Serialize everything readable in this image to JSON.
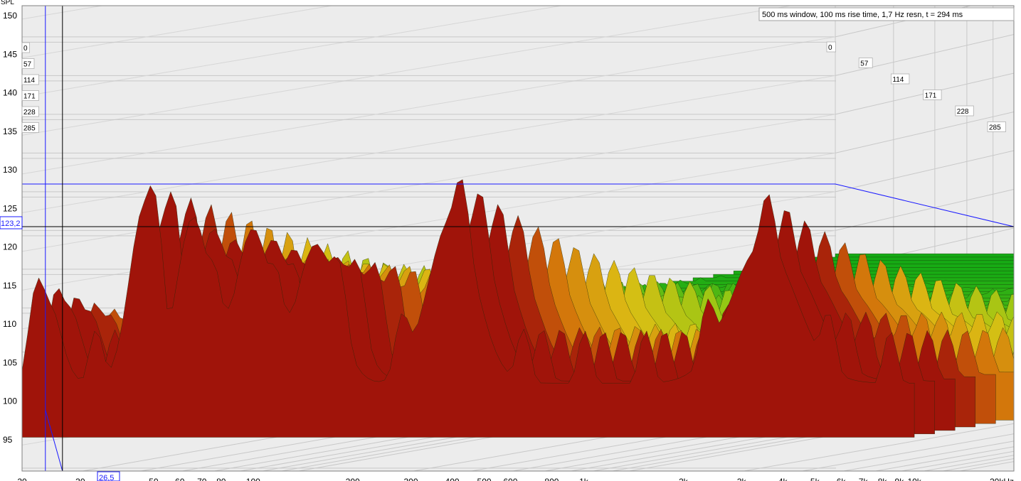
{
  "info": "500 ms window, 100 ms rise time,  1,7 Hz resn, t = 294 ms",
  "corner_label": "SPL",
  "cursor": {
    "y_label": "123,2",
    "x_label": "26,5",
    "y_value": 123.2,
    "x_value": 26.5,
    "plane_level": 128.4
  },
  "colors": {
    "cursor": "#1a1aff",
    "crosshair": "#000000",
    "grid": "#c8c8c8",
    "plot_bg": "#ececec"
  },
  "chart_data": {
    "type": "waterfall",
    "ylim": [
      91,
      151
    ],
    "y_ticks": [
      {
        "v": 150,
        "label": "150"
      },
      {
        "v": 145,
        "label": "145"
      },
      {
        "v": 140,
        "label": "140"
      },
      {
        "v": 135,
        "label": "135"
      },
      {
        "v": 130,
        "label": "130"
      },
      {
        "v": 125,
        "label": "125"
      },
      {
        "v": 120,
        "label": "120"
      },
      {
        "v": 115,
        "label": "115"
      },
      {
        "v": 110,
        "label": "110"
      },
      {
        "v": 105,
        "label": "105"
      },
      {
        "v": 100,
        "label": "100"
      },
      {
        "v": 95,
        "label": "95"
      }
    ],
    "xlim": [
      20,
      20000
    ],
    "x_scale": "log",
    "x_ticks": [
      {
        "v": 20,
        "label": "20"
      },
      {
        "v": 30,
        "label": "30"
      },
      {
        "v": 50,
        "label": "50"
      },
      {
        "v": 60,
        "label": "60"
      },
      {
        "v": 70,
        "label": "70"
      },
      {
        "v": 80,
        "label": "80"
      },
      {
        "v": 100,
        "label": "100"
      },
      {
        "v": 200,
        "label": "200"
      },
      {
        "v": 300,
        "label": "300"
      },
      {
        "v": 400,
        "label": "400"
      },
      {
        "v": 500,
        "label": "500"
      },
      {
        "v": 600,
        "label": "600"
      },
      {
        "v": 800,
        "label": "800"
      },
      {
        "v": 1000,
        "label": "1k"
      },
      {
        "v": 2000,
        "label": "2k"
      },
      {
        "v": 3000,
        "label": "3k"
      },
      {
        "v": 4000,
        "label": "4k"
      },
      {
        "v": 5000,
        "label": "5k"
      },
      {
        "v": 6000,
        "label": "6k"
      },
      {
        "v": 7000,
        "label": "7k"
      },
      {
        "v": 8000,
        "label": "8k"
      },
      {
        "v": 9000,
        "label": "9k"
      },
      {
        "v": 10000,
        "label": "10k"
      },
      {
        "v": 20000,
        "label": "20kHz"
      }
    ],
    "time_ticks": [
      {
        "v": 0,
        "label": "0"
      },
      {
        "v": 57,
        "label": "57"
      },
      {
        "v": 114,
        "label": "114"
      },
      {
        "v": 171,
        "label": "171"
      },
      {
        "v": 228,
        "label": "228"
      },
      {
        "v": 285,
        "label": "285"
      }
    ],
    "time_range_ms": [
      0,
      294
    ],
    "peaks": [
      {
        "freq": 24,
        "level": 113.5
      },
      {
        "freq": 47,
        "level": 126.0
      },
      {
        "freq": 66,
        "level": 124.5
      },
      {
        "freq": 100,
        "level": 123.0
      },
      {
        "freq": 155,
        "level": 121.0
      },
      {
        "freq": 400,
        "level": 124.5
      },
      {
        "freq": 3500,
        "level": 121.0
      }
    ],
    "freq_end": 10000
  }
}
